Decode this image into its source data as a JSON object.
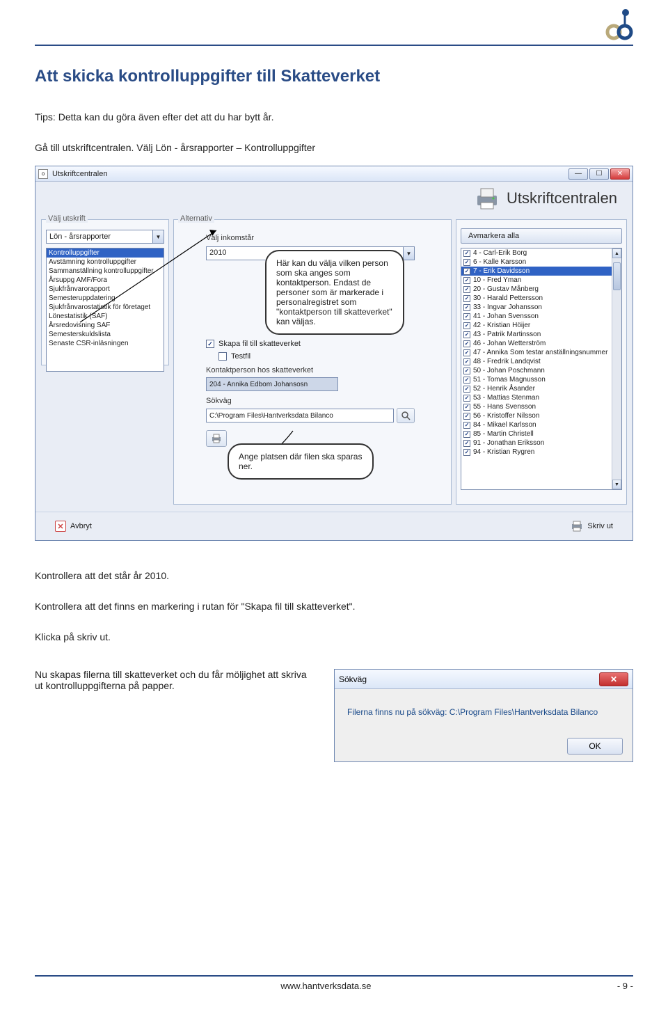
{
  "header": {
    "logo": "ob"
  },
  "heading": "Att skicka kontrolluppgifter till Skatteverket",
  "tips_text": "Tips: Detta kan du göra även efter det att du har bytt år.",
  "nav_text": "Gå till utskriftcentralen. Välj Lön - årsrapporter – Kontrolluppgifter",
  "window": {
    "title": "Utskriftcentralen",
    "banner": "Utskriftcentralen",
    "left": {
      "group_label": "Välj utskrift",
      "combo": "Lön - årsrapporter",
      "items": [
        "Kontrolluppgifter",
        "Avstämning kontrolluppgifter",
        "Sammanställning kontrolluppgifter",
        "Årsuppg AMF/Fora",
        "Sjukfrånvarorapport",
        "Semesteruppdatering",
        "Sjukfrånvarostatistik för företaget",
        "Lönestatistik (SAF)",
        "Årsredovisning SAF",
        "Semesterskuldslista",
        "Senaste CSR-inläsningen"
      ],
      "selected_index": 0
    },
    "mid": {
      "group_label": "Alternativ",
      "year_label": "Välj inkomstår",
      "year": "2010",
      "cb1": "Skapa fil till skatteverket",
      "cb2": "Testfil",
      "kontakt_label": "Kontaktperson hos skatteverket",
      "kontakt_value": "204 - Annika Edbom Johansosn",
      "path_label": "Sökväg",
      "path_value": "C:\\Program Files\\Hantverksdata Bilanco"
    },
    "right": {
      "avmarkera": "Avmarkera alla",
      "persons": [
        "4 - Carl-Erik Borg",
        "6 - Kalle Karsson",
        "7 - Erik Davidsson",
        "10 - Fred Yman",
        "20 - Gustav Månberg",
        "30 - Harald Pettersson",
        "33 - Ingvar Johansson",
        "41 - Johan Svensson",
        "42 - Kristian Höijer",
        "43 - Patrik Martinsson",
        "46 - Johan Wetterström",
        "47 - Annika Som testar anställningsnummer",
        "48 - Fredrik Landqvist",
        "50 - Johan Poschmann",
        "51 - Tomas Magnusson",
        "52 - Henrik Åsander",
        "53 - Mattias Stenman",
        "55 - Hans Svensson",
        "56 - Kristoffer Nilsson",
        "84 - Mikael Karlsson",
        "85 - Martin Christell",
        "91 - Jonathan Eriksson",
        "94 - Kristian Rygren"
      ],
      "selected_index": 2
    },
    "bottom": {
      "cancel": "Avbryt",
      "print": "Skriv ut"
    }
  },
  "callout1": "Här kan du välja vilken person som ska anges som kontaktperson. Endast de personer som är markerade i personalregistret som \"kontaktperson till skatteverket\" kan väljas.",
  "callout2": "Ange platsen där filen ska sparas ner.",
  "after1": "Kontrollera att det står år 2010.",
  "after2": "Kontrollera att det finns en markering i rutan för \"Skapa fil till skatteverket\".",
  "after3": "Klicka på skriv ut.",
  "after4a": "Nu skapas filerna till skatteverket och du får möljighet att skriva ut kontrolluppgifterna på papper.",
  "dialog": {
    "title": "Sökväg",
    "body": "Filerna finns nu på sökväg: C:\\Program Files\\Hantverksdata Bilanco",
    "ok": "OK"
  },
  "footer": {
    "url": "www.hantverksdata.se",
    "page": "- 9 -"
  }
}
